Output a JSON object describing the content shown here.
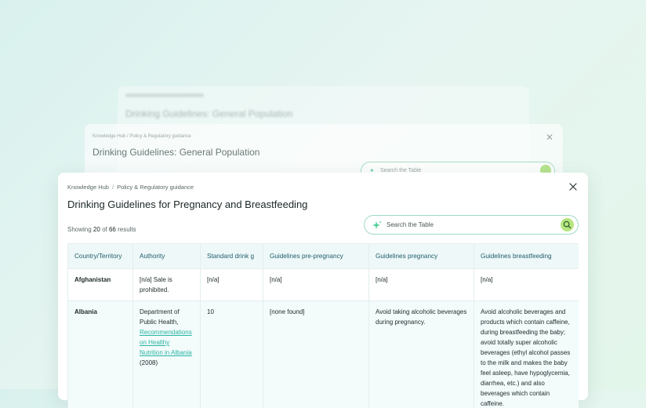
{
  "background": {
    "back_panel": {
      "title": "Drinking Guidelines: General Population"
    },
    "mid_panel": {
      "breadcrumb": {
        "root": "Knowledge Hub",
        "section": "Policy & Regulatory guidance"
      },
      "title": "Drinking Guidelines: General Population",
      "search_placeholder": "Search the Table"
    }
  },
  "modal": {
    "breadcrumb": {
      "root": "Knowledge Hub",
      "separator": "/",
      "section": "Policy & Regulatory guidance"
    },
    "title": "Drinking Guidelines for Pregnancy and Breastfeeding",
    "results": {
      "prefix": "Showing",
      "shown": "20",
      "of": "of",
      "total": "66",
      "suffix": "results"
    },
    "search": {
      "placeholder": "Search the Table",
      "value": ""
    },
    "table": {
      "headers": [
        "Country/Territory",
        "Authority",
        "Standard drink g",
        "Guidelines pre-pregnancy",
        "Guidelines pregnancy",
        "Guidelines breastfeeding"
      ],
      "rows": [
        {
          "country": "Afghanistan",
          "authority": "[n/a] Sale is prohibited.",
          "standard_drink": "[n/a]",
          "pre_pregnancy": "[n/a]",
          "pregnancy": "[n/a]",
          "breastfeeding": "[n/a]"
        },
        {
          "country": "Albania",
          "authority_prefix": "Department of Public Health,",
          "authority_link": "Recommendations on Healthy Nutrition in Albania",
          "authority_suffix": "(2008)",
          "standard_drink": "10",
          "pre_pregnancy": "[none found]",
          "pregnancy": "Avoid taking alcoholic beverages during pregnancy.",
          "breastfeeding": "Avoid alcoholic beverages and products which contain caffeine, during breastfeeding the baby; avoid totally super alcoholic beverages (ethyl alcohol passes to the milk and makes the baby feel asleep, have hypoglycemia, diarrhea, etc.) and also beverages which contain caffeine."
        }
      ]
    }
  },
  "colors": {
    "accent_green": "#b5e67f",
    "header_text": "#1e5c6a",
    "link": "#2bb5a4",
    "search_border": "#9fdcc2"
  },
  "icons": {
    "close": "close-icon",
    "sparkle": "sparkle-icon",
    "search": "search-icon"
  }
}
